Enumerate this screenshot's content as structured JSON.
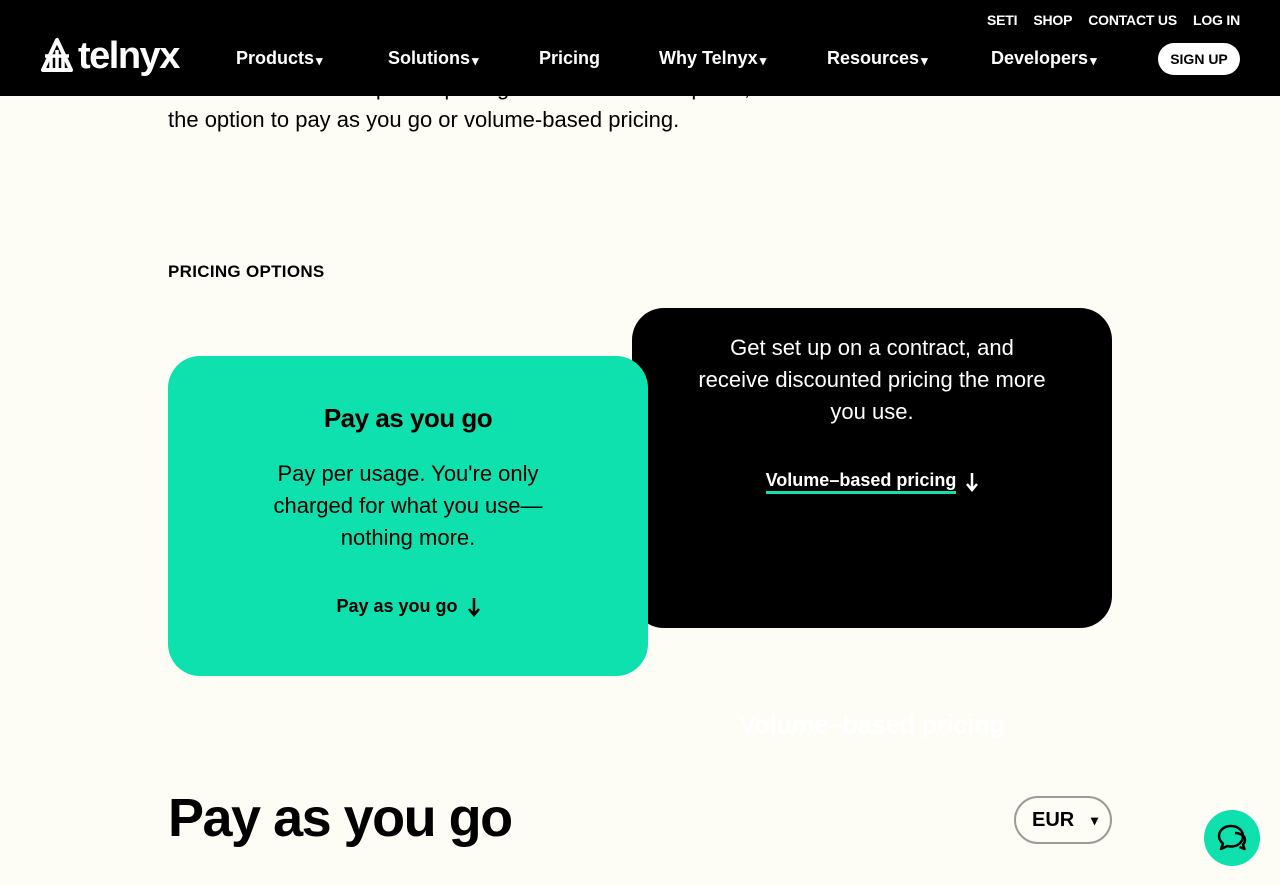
{
  "header": {
    "logo_text": "telnyx",
    "utility_links": [
      "SETI",
      "SHOP",
      "CONTACT US",
      "LOG IN"
    ],
    "nav": {
      "products": "Products",
      "solutions": "Solutions",
      "pricing": "Pricing",
      "why": "Why Telnyx",
      "resources": "Resources",
      "developers": "Developers"
    },
    "dropdown_caret": "▾",
    "signup_label": "SIGN UP"
  },
  "intro": {
    "text": "Get flexible and transparent pricing for Number Lookup API, with the option to pay as you go or volume-based pricing."
  },
  "pricing_options": {
    "label": "PRICING OPTIONS",
    "volume": {
      "title": "Volume–based pricing",
      "description": "Get set up on a contract, and receive discounted pricing the more you use.",
      "link": "Volume–based pricing"
    },
    "payg": {
      "title": "Pay as you go",
      "description": "Pay per usage. You're only charged for what you use—nothing more.",
      "link": "Pay as you go"
    }
  },
  "pay_as_you_go_section": {
    "title": "Pay as you go",
    "currency": "EUR"
  },
  "colors": {
    "accent": "#0fe1ae",
    "background": "#fefdf5",
    "header": "#000000"
  },
  "icons": {
    "arrow": "arrow-down-icon",
    "chat": "chat-support-icon"
  }
}
